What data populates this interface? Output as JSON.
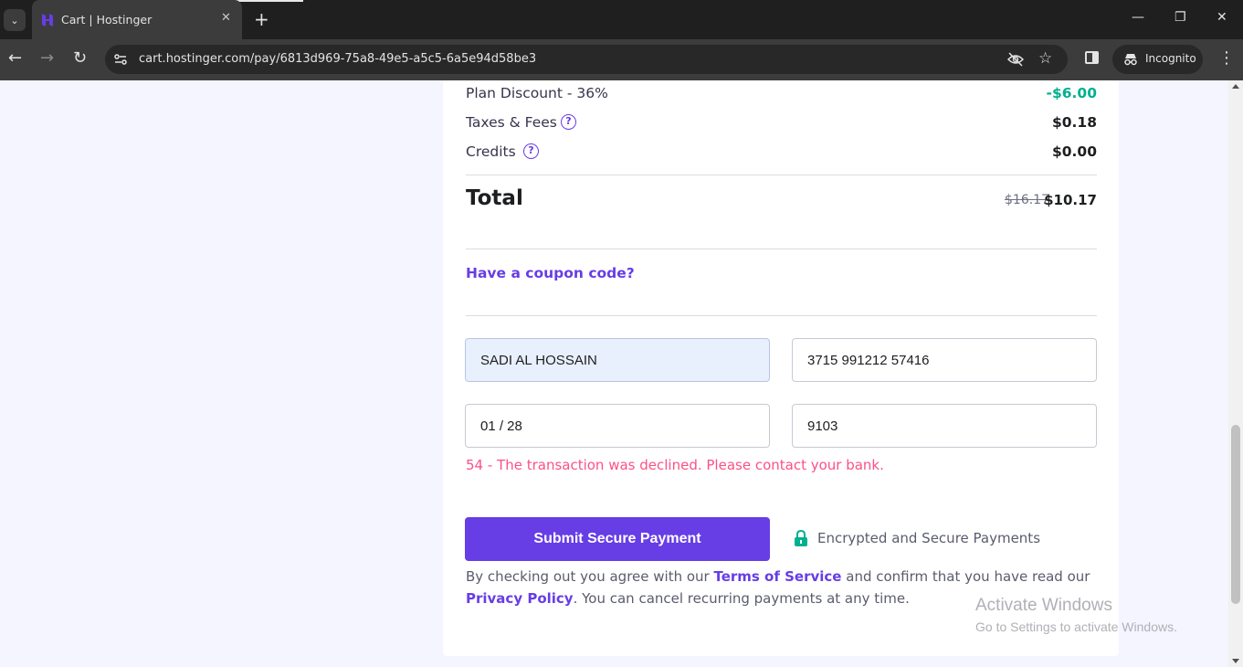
{
  "browser": {
    "tab_title": "Cart | Hostinger",
    "tab_close": "✕",
    "new_tab": "+",
    "url": "cart.hostinger.com/pay/6813d969-75a8-49e5-a5c5-6a5e94d58be3",
    "incognito_label": "Incognito",
    "window_controls": {
      "minimize": "—",
      "restore": "❐",
      "close": "✕"
    }
  },
  "summary": {
    "discount": {
      "label": "Plan Discount - 36%",
      "value": "-$6.00"
    },
    "taxes": {
      "label": "Taxes & Fees",
      "value": "$0.18"
    },
    "credits": {
      "label": "Credits",
      "value": "$0.00"
    },
    "help_glyph": "?"
  },
  "total": {
    "label": "Total",
    "old_price": "$16.17",
    "price": "$10.17"
  },
  "coupon_link": "Have a coupon code?",
  "payment_form": {
    "cardholder_name": "SADI AL HOSSAIN",
    "card_number": "3715 991212 57416",
    "expiry": "01 / 28",
    "cvc": "9103"
  },
  "error_message": "54 - The transaction was declined. Please contact your bank.",
  "submit_label": "Submit Secure Payment",
  "secure_note": "Encrypted and Secure Payments",
  "legal": {
    "prefix": "By checking out you agree with our ",
    "terms_link": "Terms of Service",
    "middle": " and confirm that you have read our ",
    "privacy_link": "Privacy Policy",
    "suffix": ". You can cancel recurring payments at any time."
  },
  "watermark": {
    "title": "Activate Windows",
    "subtitle": "Go to Settings to activate Windows."
  },
  "colors": {
    "brand_purple": "#673de6",
    "discount_green": "#00b090",
    "error_pink": "#fc5185"
  },
  "icons": [
    "tab-search-icon",
    "hostinger-logo-icon",
    "back-arrow-icon",
    "forward-arrow-icon",
    "reload-icon",
    "site-info-icon",
    "eye-off-icon",
    "star-icon",
    "side-panel-icon",
    "incognito-icon",
    "kebab-menu-icon",
    "help-icon",
    "lock-icon"
  ]
}
